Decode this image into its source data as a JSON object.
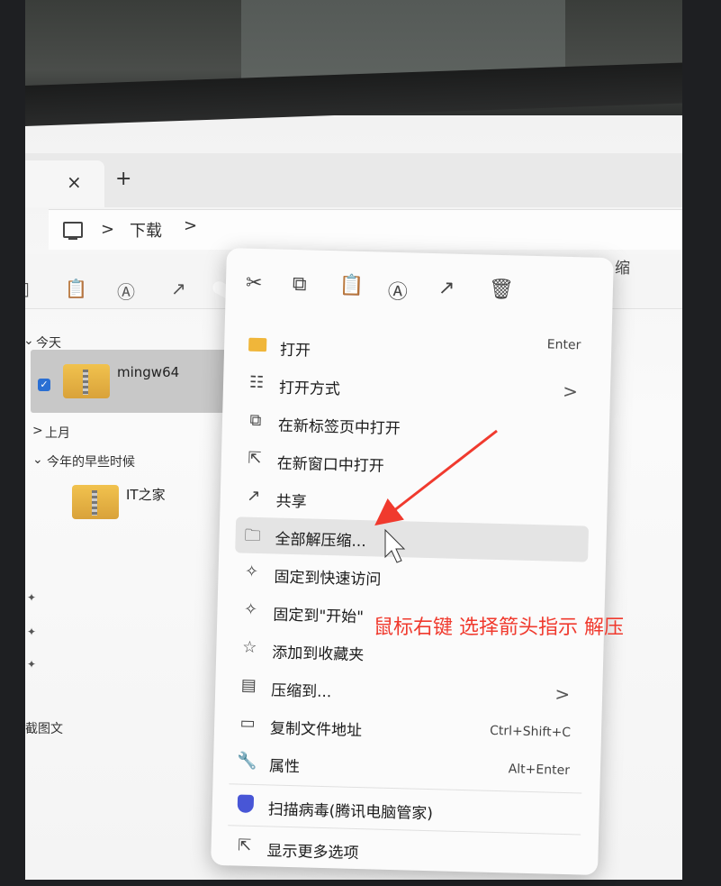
{
  "explorer": {
    "tab_close": "×",
    "tab_new": "+",
    "breadcrumb": {
      "separator": ">",
      "folder": "下载",
      "trail": ">"
    },
    "toolbar_right_fragment": "缩",
    "groups": [
      {
        "header": "今天",
        "chevron": "⌄"
      },
      {
        "header": "上月",
        "chevron": ">"
      },
      {
        "header": "今年的早些时候",
        "chevron": "⌄"
      }
    ],
    "files": [
      {
        "name": "mingw64",
        "selected": true
      },
      {
        "name": "IT之家",
        "selected": false
      }
    ],
    "side_fragment": "截图文"
  },
  "context_menu": {
    "toolbar_icons": [
      "cut-icon",
      "copy-icon",
      "paste-icon",
      "rename-icon",
      "share-icon",
      "delete-icon"
    ],
    "items": [
      {
        "label": "打开",
        "shortcut": "Enter",
        "icon": "folder-icon"
      },
      {
        "label": "打开方式",
        "submenu": ">",
        "icon": "open-with-icon"
      },
      {
        "label": "在新标签页中打开",
        "icon": "new-tab-icon"
      },
      {
        "label": "在新窗口中打开",
        "icon": "new-window-icon"
      },
      {
        "label": "共享",
        "icon": "share-icon"
      },
      {
        "label": "全部解压缩...",
        "icon": "extract-icon",
        "highlighted": true
      },
      {
        "label": "固定到快速访问",
        "icon": "pin-icon"
      },
      {
        "label": "固定到\"开始\"",
        "icon": "pin-icon"
      },
      {
        "label": "添加到收藏夹",
        "icon": "star-icon"
      },
      {
        "label": "压缩到...",
        "submenu": ">",
        "icon": "compress-icon"
      },
      {
        "label": "复制文件地址",
        "shortcut": "Ctrl+Shift+C",
        "icon": "copy-path-icon"
      },
      {
        "label": "属性",
        "shortcut": "Alt+Enter",
        "icon": "wrench-icon"
      },
      {
        "label": "扫描病毒(腾讯电脑管家)",
        "icon": "shield-icon"
      },
      {
        "label": "显示更多选项",
        "icon": "more-options-icon"
      }
    ]
  },
  "annotation": {
    "text": "鼠标右键 选择箭头指示 解压",
    "color": "#f03a2e"
  }
}
